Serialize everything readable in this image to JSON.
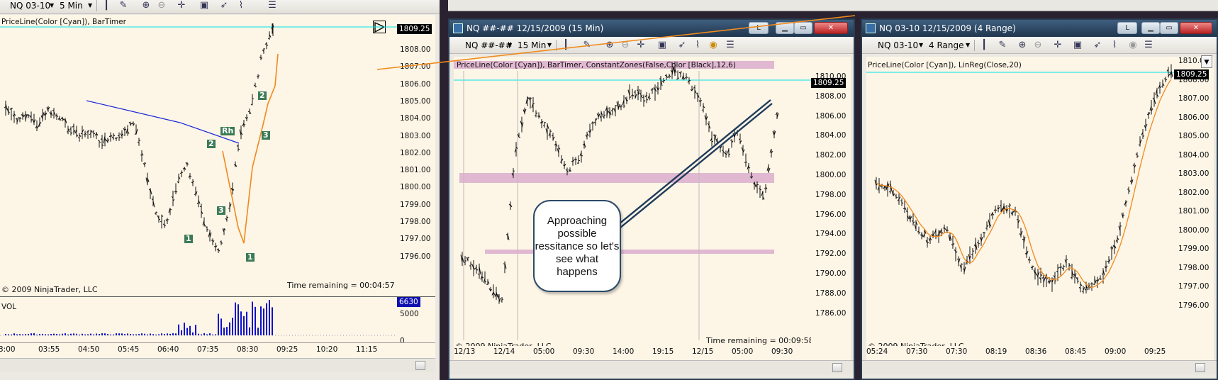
{
  "left_window": {
    "toolbar": {
      "instrument": "NQ 03-10",
      "interval": "5 Min"
    },
    "indicator_label": "PriceLine(Color [Cyan]), BarTimer",
    "price_tag": "1809.25",
    "y_ticks": [
      "1808.00",
      "1807.00",
      "1806.00",
      "1805.00",
      "1804.00",
      "1803.00",
      "1802.00",
      "1801.00",
      "1800.00",
      "1799.00",
      "1798.00",
      "1797.00",
      "1796.00"
    ],
    "copyright": "© 2009 NinjaTrader, LLC",
    "time_remaining": "Time remaining = 00:04:57",
    "volume": {
      "label": "VOL",
      "tag": "6630",
      "ticks": [
        "5000",
        "0"
      ]
    },
    "x_ticks": [
      "3:00",
      "03:55",
      "04:50",
      "05:45",
      "06:40",
      "07:35",
      "08:30",
      "09:25",
      "10:20",
      "11:15"
    ],
    "marks": [
      "1",
      "2",
      "3",
      "Rh",
      "1",
      "2",
      "3"
    ]
  },
  "middle_window": {
    "title": "NQ ##-##  12/15/2009 (15 Min)",
    "title_button": "L",
    "toolbar": {
      "instrument": "NQ ##-##",
      "interval": "15 Min"
    },
    "indicator_label": "PriceLine(Color [Cyan]), BarTimer, ConstantZones(False,Color [Black],12,6)",
    "price_tag": "1809.25",
    "y_ticks": [
      "1810.00",
      "1808.00",
      "1806.00",
      "1804.00",
      "1802.00",
      "1800.00",
      "1798.00",
      "1796.00",
      "1794.00",
      "1792.00",
      "1790.00",
      "1788.00",
      "1786.00"
    ],
    "copyright": "© 2009 NinjaTrader, LLC",
    "time_remaining": "Time remaining = 00:09:58",
    "x_ticks": [
      "12/13",
      "12/14",
      "05:00",
      "09:30",
      "14:00",
      "19:15",
      "12/15",
      "05:00",
      "09:30"
    ],
    "callout": "Approaching possible ressitance so let's see what happens"
  },
  "right_window": {
    "title": "NQ 03-10  12/15/2009 (4 Range)",
    "title_button": "L",
    "toolbar": {
      "instrument": "NQ 03-10",
      "interval": "4 Range"
    },
    "indicator_label": "PriceLine(Color [Cyan]), LinReg(Close,20)",
    "price_tag": "1809.25",
    "y_ticks": [
      "1810.00",
      "1808.00",
      "1807.00",
      "1806.00",
      "1805.00",
      "1804.00",
      "1803.00",
      "1802.00",
      "1801.00",
      "1800.00",
      "1799.00",
      "1798.00",
      "1797.00",
      "1796.00"
    ],
    "copyright": "© 2009 NinjaTrader, LLC",
    "x_ticks": [
      "05:24",
      "07:30",
      "07:30",
      "08:19",
      "08:36",
      "08:45",
      "09:00",
      "09:25"
    ]
  },
  "colors": {
    "chart_bg": "#fdf5e6",
    "zone": "#d9a9cc",
    "priceline": "#00e5e5",
    "drawn_line": "#f08a1c",
    "trend_line": "#1a2ad8",
    "volume": "#1010c8"
  }
}
